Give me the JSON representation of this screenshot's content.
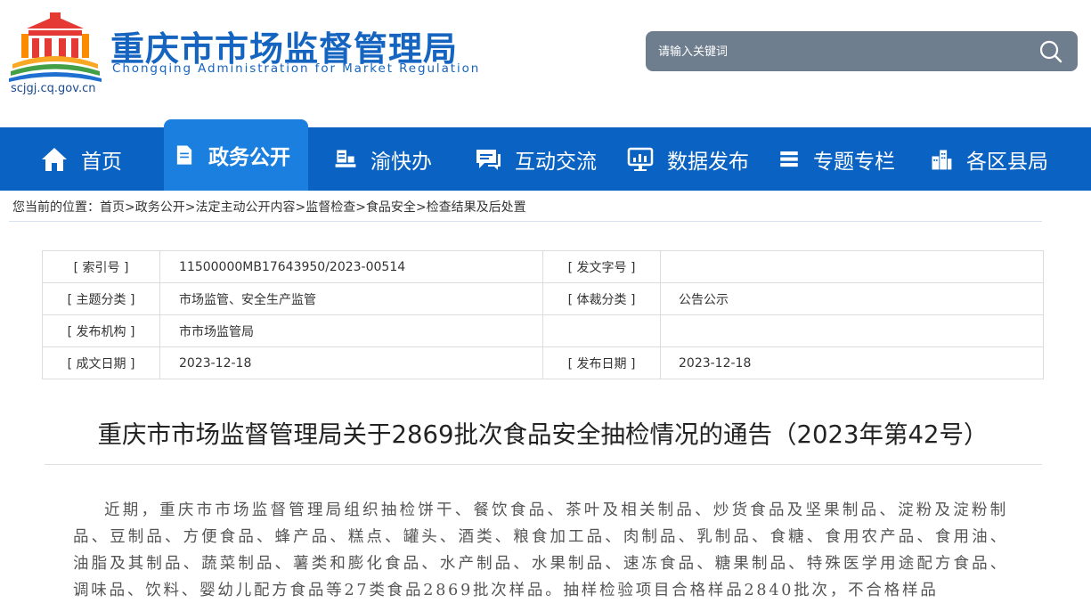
{
  "header": {
    "title": "重庆市市场监督管理局",
    "subtitle": "Chongqing  Administration for Market Regulation",
    "url": "scjgj.cq.gov.cn",
    "search": {
      "placeholder": "请输入关键词"
    }
  },
  "nav": {
    "items": [
      {
        "label": "首页",
        "icon": "home-icon"
      },
      {
        "label": "政务公开",
        "icon": "document-icon"
      },
      {
        "label": "渝快办",
        "icon": "desk-icon"
      },
      {
        "label": "互动交流",
        "icon": "chat-icon"
      },
      {
        "label": "数据发布",
        "icon": "monitor-icon"
      },
      {
        "label": "专题专栏",
        "icon": "stack-icon"
      },
      {
        "label": "各区县局",
        "icon": "buildings-icon"
      }
    ],
    "active_index": 1
  },
  "breadcrumb": {
    "prefix": "您当前的位置：",
    "items": [
      "首页",
      "政务公开",
      "法定主动公开内容",
      "监督检查",
      "食品安全",
      "检查结果及后处置"
    ],
    "separator": ">"
  },
  "meta": {
    "rows": [
      {
        "k1": "[ 索引号 ]",
        "v1": "11500000MB17643950/2023-00514",
        "k2": "[ 发文字号 ]",
        "v2": ""
      },
      {
        "k1": "[ 主题分类 ]",
        "v1": "市场监管、安全生产监管",
        "k2": "[ 体裁分类 ]",
        "v2": "公告公示"
      },
      {
        "k1": "[ 发布机构 ]",
        "v1": "市市场监管局",
        "k2": "",
        "v2": ""
      },
      {
        "k1": "[ 成文日期 ]",
        "v1": "2023-12-18",
        "k2": "[ 发布日期 ]",
        "v2": "2023-12-18"
      }
    ]
  },
  "article": {
    "title": "重庆市市场监督管理局关于2869批次食品安全抽检情况的通告（2023年第42号）",
    "body": "近期，重庆市市场监督管理局组织抽检饼干、餐饮食品、茶叶及相关制品、炒货食品及坚果制品、淀粉及淀粉制品、豆制品、方便食品、蜂产品、糕点、罐头、酒类、粮食加工品、肉制品、乳制品、食糖、食用农产品、食用油、油脂及其制品、蔬菜制品、薯类和膨化食品、水产制品、水果制品、速冻食品、糖果制品、特殊医学用途配方食品、调味品、饮料、婴幼儿配方食品等27类食品2869批次样品。抽样检验项目合格样品2840批次，不合格样品"
  },
  "colors": {
    "brand_blue": "#1565c0",
    "nav_bg": "#0a63c2",
    "nav_active": "#1b7fe0",
    "search_bg": "#6e7e8e"
  }
}
